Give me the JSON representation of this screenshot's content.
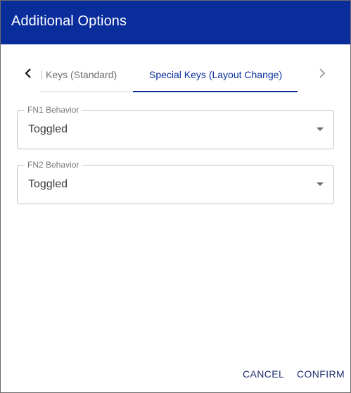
{
  "dialog": {
    "title": "Additional Options"
  },
  "tabs": {
    "items": [
      {
        "label": "Keys (Standard)",
        "selected": false
      },
      {
        "label": "Special Keys (Layout Change)",
        "selected": true
      }
    ],
    "scroll_left_icon": "chevron-left-icon",
    "scroll_right_icon": "chevron-right-icon"
  },
  "fields": [
    {
      "label": "FN1 Behavior",
      "value": "Toggled"
    },
    {
      "label": "FN2 Behavior",
      "value": "Toggled"
    }
  ],
  "actions": {
    "cancel_label": "CANCEL",
    "confirm_label": "CONFIRM"
  },
  "colors": {
    "header_bg": "#0a2d9c",
    "accent": "#0a2d9c",
    "action_text": "#1f2f6e"
  }
}
